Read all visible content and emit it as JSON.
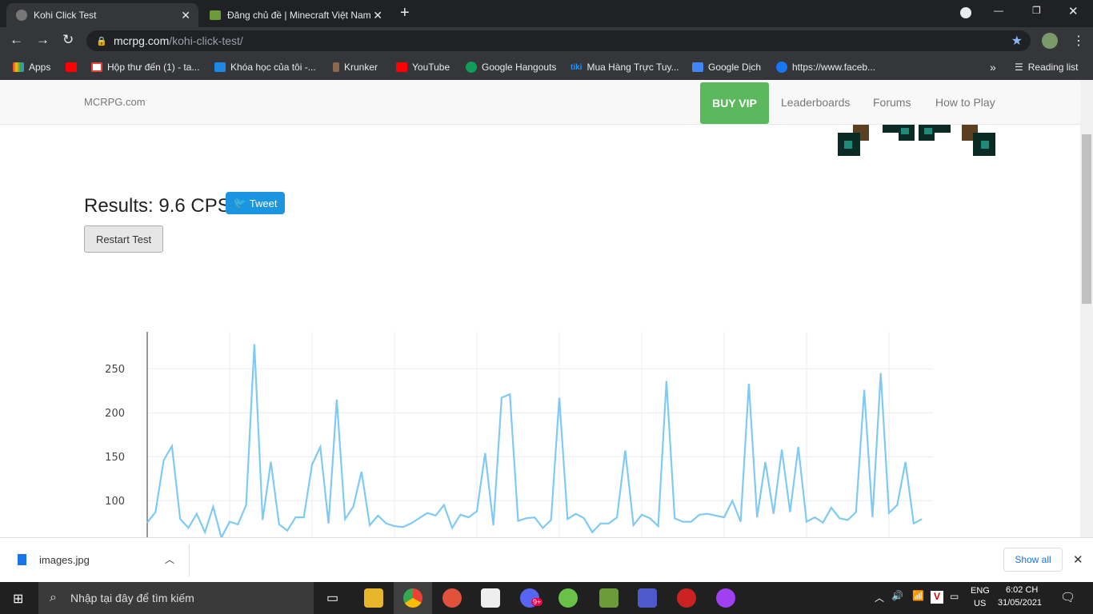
{
  "browser": {
    "tabs": [
      {
        "title": "Kohi Click Test",
        "active": true
      },
      {
        "title": "Đăng chủ đề | Minecraft Việt Nam",
        "active": false
      }
    ],
    "url_host": "mcrpg.com",
    "url_path": "/kohi-click-test/",
    "bookmarks": [
      "Apps",
      "",
      "Hộp thư đến (1) - ta...",
      "Khóa học của tôi -...",
      "Krunker",
      "YouTube",
      "Google Hangouts",
      "Mua Hàng Trực Tuy...",
      "Google Dịch",
      "https://www.faceb..."
    ],
    "reading_list": "Reading list",
    "more": "»"
  },
  "site": {
    "brand": "MCRPG.com",
    "nav": {
      "vip": "BUY VIP",
      "links": [
        "Leaderboards",
        "Forums",
        "How to Play"
      ]
    },
    "results": "Results: 9.6 CPS",
    "tweet": "Tweet",
    "restart": "Restart Test"
  },
  "chart_data": {
    "type": "line",
    "title": "",
    "xlabel": "",
    "ylabel": "",
    "ylim": [
      55,
      292
    ],
    "yticks": [
      100,
      150,
      200,
      250
    ],
    "ytick_labels": [
      "100",
      "150",
      "200",
      "250"
    ],
    "grid": true,
    "color": "#7fcaf5",
    "values": [
      75,
      87,
      146,
      162,
      79,
      69,
      85,
      64,
      93,
      58,
      76,
      73,
      95,
      278,
      78,
      144,
      73,
      66,
      81,
      81,
      141,
      161,
      74,
      215,
      79,
      93,
      133,
      72,
      83,
      74,
      71,
      70,
      74,
      80,
      86,
      83,
      95,
      69,
      84,
      81,
      88,
      154,
      72,
      217,
      221,
      77,
      80,
      81,
      69,
      78,
      217,
      79,
      85,
      80,
      64,
      74,
      74,
      81,
      157,
      72,
      84,
      80,
      71,
      236,
      80,
      76,
      76,
      84,
      85,
      83,
      81,
      100,
      76,
      233,
      81,
      144,
      85,
      158,
      87,
      161,
      76,
      81,
      75,
      92,
      80,
      78,
      87,
      226,
      81,
      245,
      86,
      95,
      144,
      74,
      79
    ]
  },
  "download": {
    "file": "images.jpg",
    "show_all": "Show all"
  },
  "taskbar": {
    "search": "Nhập tại đây để tìm kiếm",
    "lang1": "ENG",
    "lang2": "US",
    "time": "6:02 CH",
    "date": "31/05/2021",
    "badge": "9+"
  }
}
